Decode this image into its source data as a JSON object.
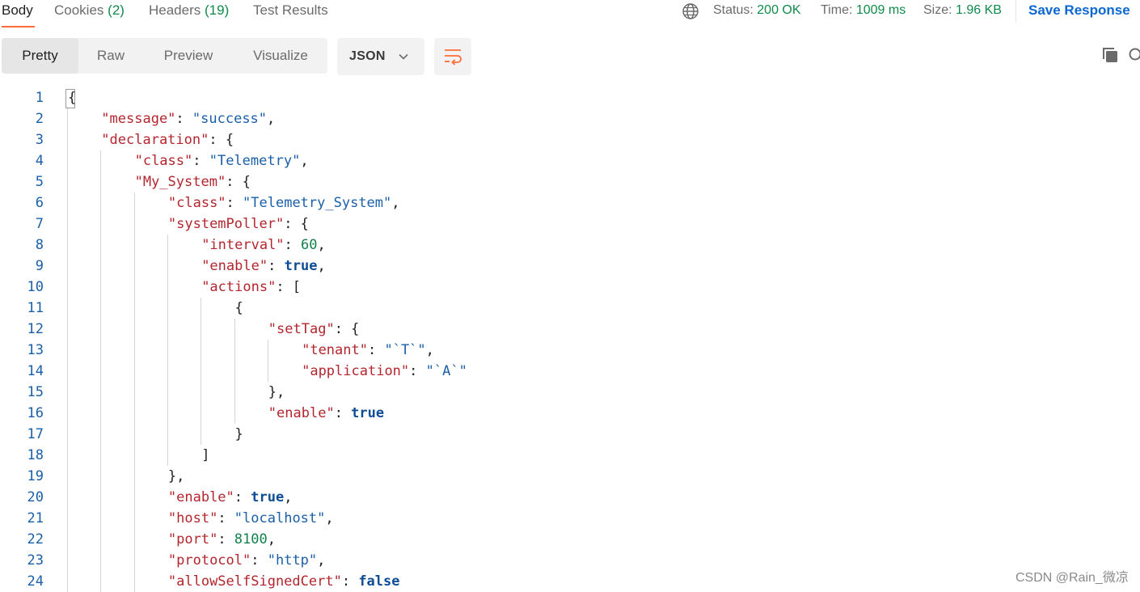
{
  "tabs": {
    "body": "Body",
    "cookies": "Cookies",
    "cookies_count": "(2)",
    "headers": "Headers",
    "headers_count": "(19)",
    "test_results": "Test Results"
  },
  "status": {
    "status_label": "Status:",
    "status_value": "200 OK",
    "time_label": "Time:",
    "time_value": "1009 ms",
    "size_label": "Size:",
    "size_value": "1.96 KB",
    "save_label": "Save Response"
  },
  "view_modes": [
    "Pretty",
    "Raw",
    "Preview",
    "Visualize"
  ],
  "active_view_mode": "Pretty",
  "format": {
    "selected": "JSON"
  },
  "icons": {
    "globe": "globe-icon",
    "dropdown": "chevron-down-icon",
    "wrap": "wrap-lines-icon",
    "copy": "copy-icon",
    "search": "search-icon"
  },
  "colors": {
    "accent": "#ff6c37",
    "status_green": "#0f8a4b",
    "link_blue": "#0b66d1",
    "json_key": "#b3262e",
    "json_string": "#1a5fa8",
    "json_number": "#11824b",
    "json_boolean": "#0e4d95"
  },
  "code_lines": [
    {
      "num": "1",
      "level": 0,
      "tokens": [
        {
          "t": "p",
          "v": "{"
        }
      ]
    },
    {
      "num": "2",
      "level": 1,
      "tokens": [
        {
          "t": "k",
          "v": "\"message\""
        },
        {
          "t": "p",
          "v": ": "
        },
        {
          "t": "s",
          "v": "\"success\""
        },
        {
          "t": "p",
          "v": ","
        }
      ]
    },
    {
      "num": "3",
      "level": 1,
      "tokens": [
        {
          "t": "k",
          "v": "\"declaration\""
        },
        {
          "t": "p",
          "v": ": {"
        }
      ]
    },
    {
      "num": "4",
      "level": 2,
      "tokens": [
        {
          "t": "k",
          "v": "\"class\""
        },
        {
          "t": "p",
          "v": ": "
        },
        {
          "t": "s",
          "v": "\"Telemetry\""
        },
        {
          "t": "p",
          "v": ","
        }
      ]
    },
    {
      "num": "5",
      "level": 2,
      "tokens": [
        {
          "t": "k",
          "v": "\"My_System\""
        },
        {
          "t": "p",
          "v": ": {"
        }
      ]
    },
    {
      "num": "6",
      "level": 3,
      "tokens": [
        {
          "t": "k",
          "v": "\"class\""
        },
        {
          "t": "p",
          "v": ": "
        },
        {
          "t": "s",
          "v": "\"Telemetry_System\""
        },
        {
          "t": "p",
          "v": ","
        }
      ]
    },
    {
      "num": "7",
      "level": 3,
      "tokens": [
        {
          "t": "k",
          "v": "\"systemPoller\""
        },
        {
          "t": "p",
          "v": ": {"
        }
      ]
    },
    {
      "num": "8",
      "level": 4,
      "tokens": [
        {
          "t": "k",
          "v": "\"interval\""
        },
        {
          "t": "p",
          "v": ": "
        },
        {
          "t": "n",
          "v": "60"
        },
        {
          "t": "p",
          "v": ","
        }
      ]
    },
    {
      "num": "9",
      "level": 4,
      "tokens": [
        {
          "t": "k",
          "v": "\"enable\""
        },
        {
          "t": "p",
          "v": ": "
        },
        {
          "t": "b",
          "v": "true"
        },
        {
          "t": "p",
          "v": ","
        }
      ]
    },
    {
      "num": "10",
      "level": 4,
      "tokens": [
        {
          "t": "k",
          "v": "\"actions\""
        },
        {
          "t": "p",
          "v": ": ["
        }
      ]
    },
    {
      "num": "11",
      "level": 5,
      "tokens": [
        {
          "t": "p",
          "v": "{"
        }
      ]
    },
    {
      "num": "12",
      "level": 6,
      "tokens": [
        {
          "t": "k",
          "v": "\"setTag\""
        },
        {
          "t": "p",
          "v": ": {"
        }
      ]
    },
    {
      "num": "13",
      "level": 7,
      "tokens": [
        {
          "t": "k",
          "v": "\"tenant\""
        },
        {
          "t": "p",
          "v": ": "
        },
        {
          "t": "s",
          "v": "\"`T`\""
        },
        {
          "t": "p",
          "v": ","
        }
      ]
    },
    {
      "num": "14",
      "level": 7,
      "tokens": [
        {
          "t": "k",
          "v": "\"application\""
        },
        {
          "t": "p",
          "v": ": "
        },
        {
          "t": "s",
          "v": "\"`A`\""
        }
      ]
    },
    {
      "num": "15",
      "level": 6,
      "tokens": [
        {
          "t": "p",
          "v": "},"
        }
      ]
    },
    {
      "num": "16",
      "level": 6,
      "tokens": [
        {
          "t": "k",
          "v": "\"enable\""
        },
        {
          "t": "p",
          "v": ": "
        },
        {
          "t": "b",
          "v": "true"
        }
      ]
    },
    {
      "num": "17",
      "level": 5,
      "tokens": [
        {
          "t": "p",
          "v": "}"
        }
      ]
    },
    {
      "num": "18",
      "level": 4,
      "tokens": [
        {
          "t": "p",
          "v": "]"
        }
      ]
    },
    {
      "num": "19",
      "level": 3,
      "tokens": [
        {
          "t": "p",
          "v": "},"
        }
      ]
    },
    {
      "num": "20",
      "level": 3,
      "tokens": [
        {
          "t": "k",
          "v": "\"enable\""
        },
        {
          "t": "p",
          "v": ": "
        },
        {
          "t": "b",
          "v": "true"
        },
        {
          "t": "p",
          "v": ","
        }
      ]
    },
    {
      "num": "21",
      "level": 3,
      "tokens": [
        {
          "t": "k",
          "v": "\"host\""
        },
        {
          "t": "p",
          "v": ": "
        },
        {
          "t": "s",
          "v": "\"localhost\""
        },
        {
          "t": "p",
          "v": ","
        }
      ]
    },
    {
      "num": "22",
      "level": 3,
      "tokens": [
        {
          "t": "k",
          "v": "\"port\""
        },
        {
          "t": "p",
          "v": ": "
        },
        {
          "t": "n",
          "v": "8100"
        },
        {
          "t": "p",
          "v": ","
        }
      ]
    },
    {
      "num": "23",
      "level": 3,
      "tokens": [
        {
          "t": "k",
          "v": "\"protocol\""
        },
        {
          "t": "p",
          "v": ": "
        },
        {
          "t": "s",
          "v": "\"http\""
        },
        {
          "t": "p",
          "v": ","
        }
      ]
    },
    {
      "num": "24",
      "level": 3,
      "tokens": [
        {
          "t": "k",
          "v": "\"allowSelfSignedCert\""
        },
        {
          "t": "p",
          "v": ": "
        },
        {
          "t": "b",
          "v": "false"
        }
      ]
    }
  ],
  "watermark": "CSDN @Rain_微凉"
}
